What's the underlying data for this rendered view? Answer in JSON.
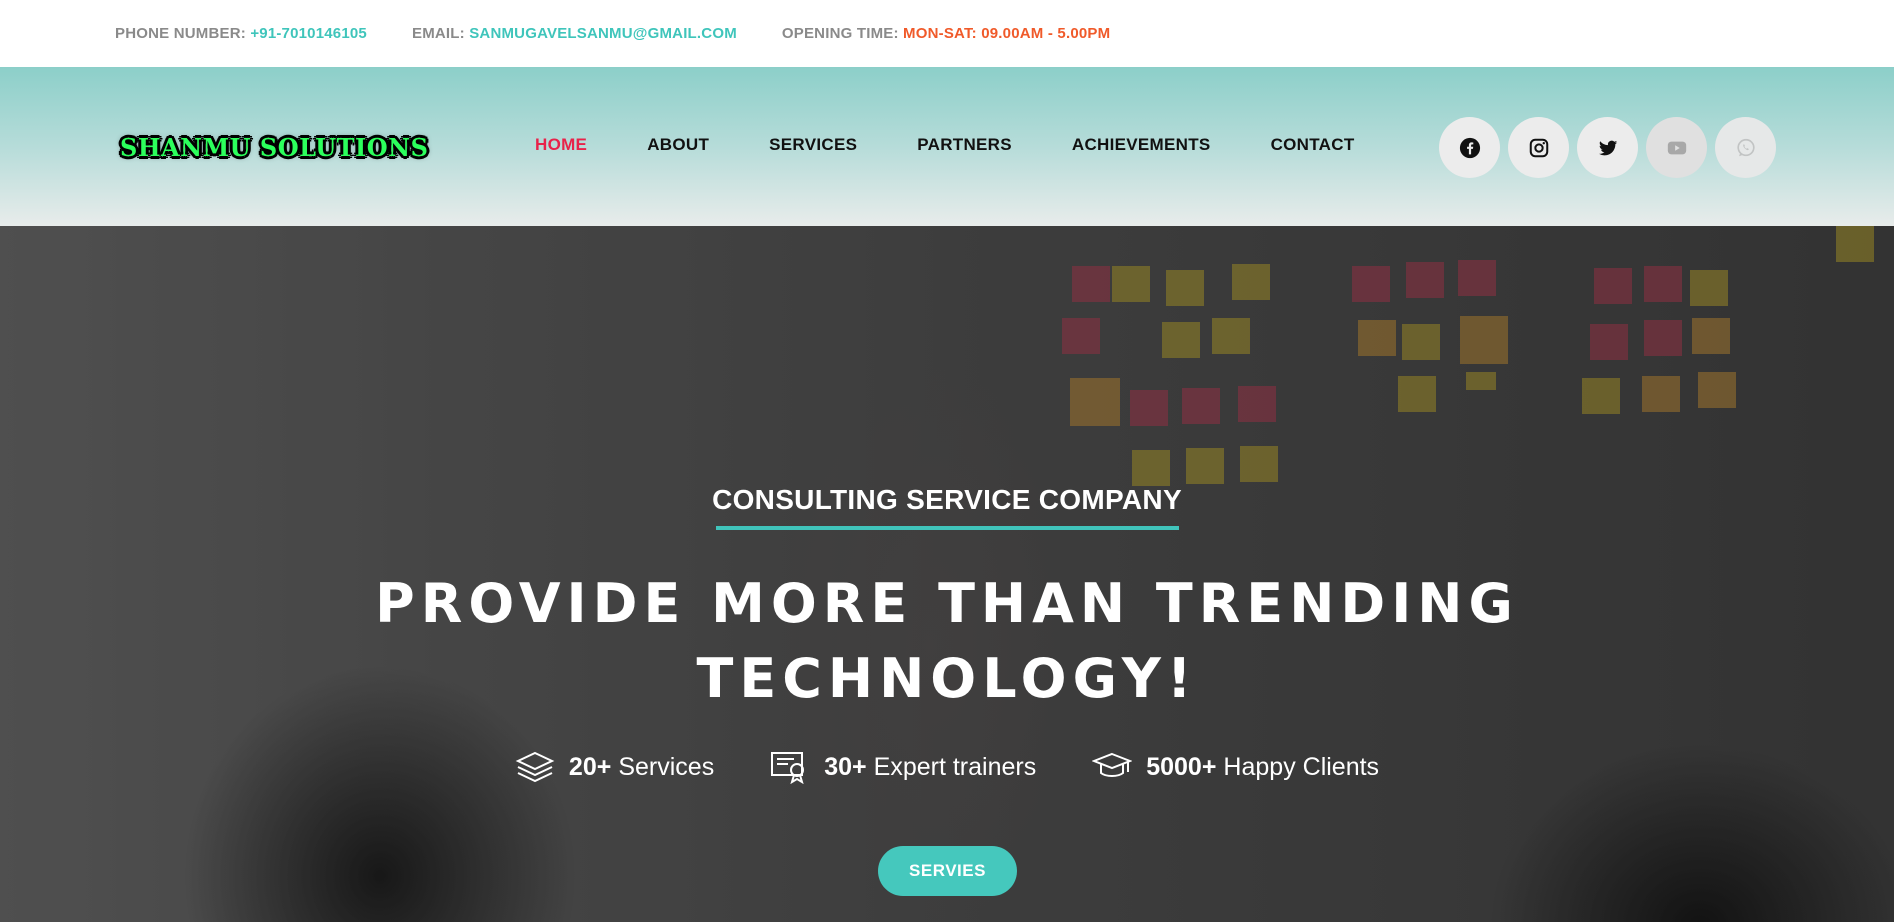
{
  "topbar": {
    "phone_label": "PHONE NUMBER:",
    "phone_value": "+91-7010146105",
    "email_label": "EMAIL:",
    "email_value": "SANMUGAVELSANMU@GMAIL.COM",
    "hours_label": "OPENING TIME:",
    "hours_value": "MON-SAT: 09.00AM - 5.00PM"
  },
  "header": {
    "logo_text": "SHANMU SOLUTIONS",
    "nav": [
      {
        "label": "HOME",
        "active": true
      },
      {
        "label": "ABOUT",
        "active": false
      },
      {
        "label": "SERVICES",
        "active": false
      },
      {
        "label": "PARTNERS",
        "active": false
      },
      {
        "label": "ACHIEVEMENTS",
        "active": false
      },
      {
        "label": "CONTACT",
        "active": false
      }
    ],
    "social": [
      "facebook-icon",
      "instagram-icon",
      "twitter-icon",
      "youtube-icon",
      "whatsapp-icon"
    ]
  },
  "hero": {
    "tagline": "CONSULTING SERVICE COMPANY",
    "headline_line1": "PROVIDE MORE THAN TRENDING",
    "headline_line2": "TECHNOLOGY!",
    "stats": [
      {
        "icon": "layers-icon",
        "number": "20+",
        "label": "Services"
      },
      {
        "icon": "certificate-icon",
        "number": "30+",
        "label": "Expert trainers"
      },
      {
        "icon": "graduation-cap-icon",
        "number": "5000+",
        "label": "Happy Clients"
      }
    ],
    "cta_label": "SERVIES"
  },
  "colors": {
    "accent_teal": "#40c4bb",
    "active_nav": "#e8234a",
    "hours_orange": "#f05a2a"
  }
}
